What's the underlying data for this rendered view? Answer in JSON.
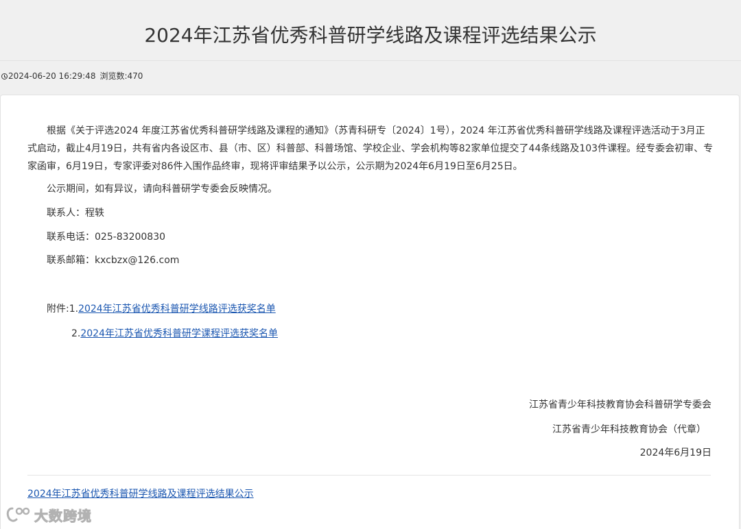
{
  "header": {
    "title": "2024年江苏省优秀科普研学线路及课程评选结果公示"
  },
  "meta": {
    "icon": "clock-icon",
    "datetime": "2024-06-20 16:29:48",
    "views": "浏览数:470"
  },
  "article": {
    "paragraphs": [
      "根据《关于评选2024 年度江苏省优秀科普研学线路及课程的通知》（苏青科研专〔2024〕1号），2024 年江苏省优秀科普研学线路及课程评选活动于3月正式启动，截止4月19日，共有省内各设区市、县（市、区）科普部、科普场馆、学校企业、学会机构等82家单位提交了44条线路及103件课程。经专委会初审、专家函审，6月19日，专家评委对86件入围作品终审，现将评审结果予以公示，公示期为2024年6月19日至6月25日。",
      "公示期间，如有异议，请向科普研学专委会反映情况。",
      "联系人：程轶",
      "联系电话：025-83200830",
      "联系邮箱：kxcbzx@126.com"
    ],
    "attachments": {
      "prefix_1": "附件:1.",
      "link_1": "2024年江苏省优秀科普研学线路评选获奖名单",
      "prefix_2": "2.",
      "link_2": "2024年江苏省优秀科普研学课程评选获奖名单"
    },
    "signature": {
      "line_1": "江苏省青少年科技教育协会科普研学专委会",
      "line_2": "江苏省青少年科技教育协会（代章）",
      "date": "2024年6月19日"
    }
  },
  "footer": {
    "link": "2024年江苏省优秀科普研学线路及课程评选结果公示"
  },
  "watermark": {
    "text": "大数跨境"
  },
  "colors": {
    "link": "#1a56b0",
    "background": "#f0f0f0",
    "panel": "#ffffff",
    "text": "#333333"
  }
}
